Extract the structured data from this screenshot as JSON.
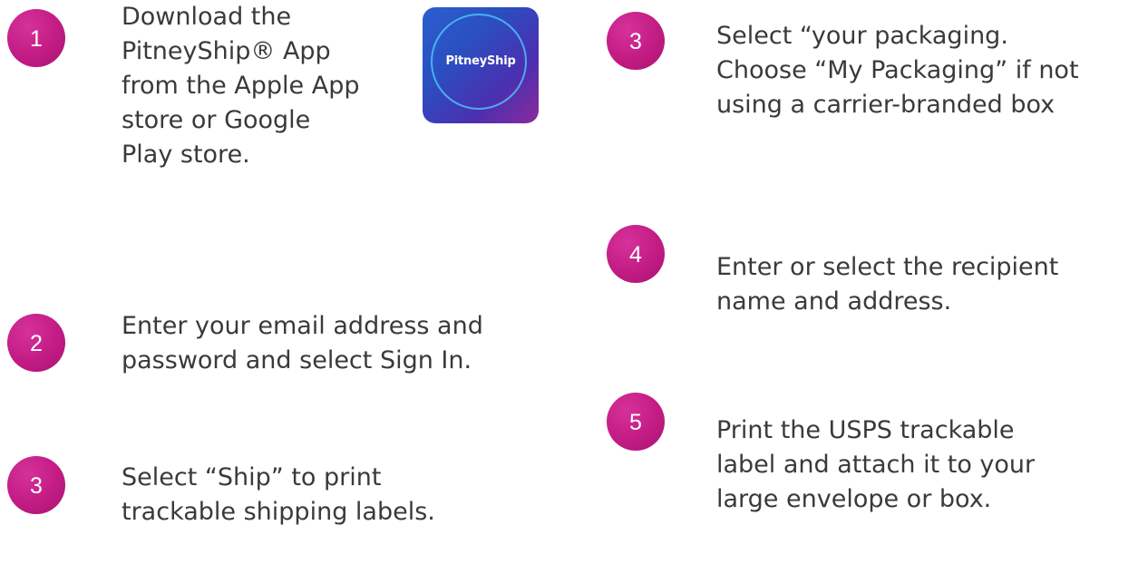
{
  "steps_left": [
    {
      "number": "1",
      "text": "Download the\nPitneyShip® App\nfrom the Apple App\nstore or Google\nPlay store."
    },
    {
      "number": "2",
      "text": "Enter your email address and\npassword and select Sign In."
    },
    {
      "number": "3",
      "text": "Select “Ship” to print\ntrackable shipping labels."
    }
  ],
  "steps_right": [
    {
      "number": "3",
      "text": "Select “your packaging.\nChoose “My Packaging” if not\nusing a carrier-branded box"
    },
    {
      "number": "4",
      "text": "Enter or select the recipient\nname and address."
    },
    {
      "number": "5",
      "text": "Print the USPS trackable\nlabel and attach it to your\nlarge envelope or box."
    }
  ],
  "app_icon": {
    "label": "PitneyShip",
    "colors": {
      "gradient_start": "#2d5fcf",
      "gradient_end": "#8b2a9c",
      "ring": "#50d2ff"
    }
  },
  "accent_color": "#c21c84"
}
